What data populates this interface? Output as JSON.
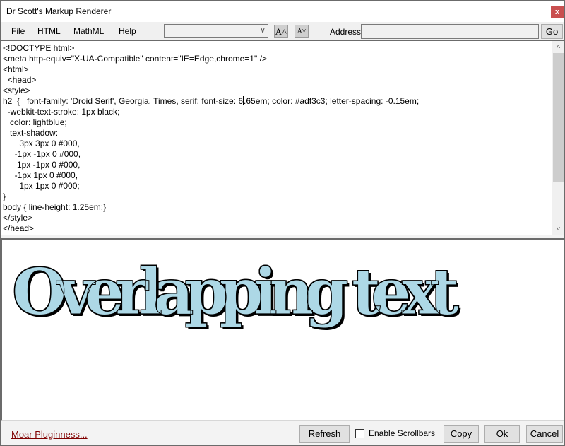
{
  "window": {
    "title": "Dr Scott's Markup Renderer",
    "close_glyph": "x"
  },
  "menubar": {
    "items": [
      {
        "label": "File"
      },
      {
        "label": "HTML"
      },
      {
        "label": "MathML"
      },
      {
        "label": "Help"
      }
    ],
    "combo_value": "",
    "combo_arrow": "∨",
    "font_increase_label": "A˄",
    "font_decrease_label": "A˅",
    "address_label": "Address:",
    "address_value": "",
    "go_label": "Go"
  },
  "editor": {
    "lines_before_caret": "<!DOCTYPE html>\n<meta http-equiv=\"X-UA-Compatible\" content=\"IE=Edge,chrome=1\" />\n<html>\n  <head>\n<style>\nh2  {   font-family: 'Droid Serif', Georgia, Times, serif; font-size: 6",
    "lines_after_caret": ".65em; color: #adf3c3; letter-spacing: -0.15em;\n  -webkit-text-stroke: 1px black;\n   color: lightblue;\n   text-shadow:\n       3px 3px 0 #000,\n     -1px -1px 0 #000,\n      1px -1px 0 #000,\n     -1px 1px 0 #000,\n       1px 1px 0 #000;\n}\nbody { line-height: 1.25em;}\n</style>\n</head>",
    "scroll_up_glyph": "˄",
    "scroll_down_glyph": "˅"
  },
  "preview": {
    "heading_text": "Overlapping text"
  },
  "footer": {
    "link_label": "Moar Pluginness...",
    "refresh_label": "Refresh",
    "checkbox_label": "Enable Scrollbars",
    "checkbox_checked": false,
    "copy_label": "Copy",
    "ok_label": "Ok",
    "cancel_label": "Cancel"
  }
}
